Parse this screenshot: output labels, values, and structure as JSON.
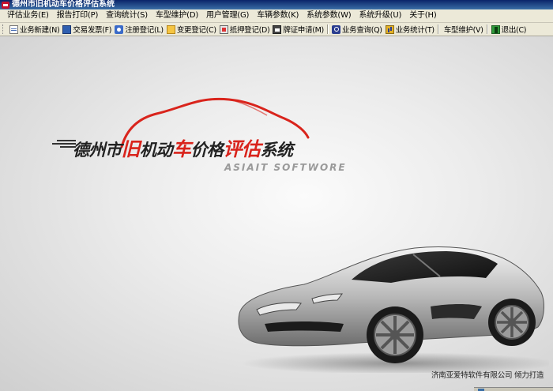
{
  "window": {
    "title": "德州市旧机动车价格评估系统"
  },
  "menu": [
    {
      "label": "评估业务(E)"
    },
    {
      "label": "报告打印(P)"
    },
    {
      "label": "查询统计(S)"
    },
    {
      "label": "车型维护(D)"
    },
    {
      "label": "用户管理(G)"
    },
    {
      "label": "车辆参数(K)"
    },
    {
      "label": "系统参数(W)"
    },
    {
      "label": "系统升级(U)"
    },
    {
      "label": "关于(H)"
    }
  ],
  "toolbar": [
    {
      "label": "业务新建(N)",
      "icon": "new-document-icon"
    },
    {
      "label": "交易发票(F)",
      "icon": "invoice-icon"
    },
    {
      "label": "注册登记(L)",
      "icon": "register-icon"
    },
    {
      "label": "变更登记(C)",
      "icon": "change-icon"
    },
    {
      "label": "抵押登记(D)",
      "icon": "pledge-icon"
    },
    {
      "label": "牌证申请(M)",
      "icon": "license-icon"
    },
    {
      "label": "业务查询(Q)",
      "icon": "search-icon"
    },
    {
      "label": "业务统计(T)",
      "icon": "stats-icon"
    },
    {
      "label": "车型维护(V)",
      "icon": "car-icon"
    },
    {
      "label": "退出(C)",
      "icon": "exit-icon"
    }
  ],
  "splash": {
    "title_part1": "德州市",
    "title_part2": "旧",
    "title_part3": "机动",
    "title_part4": "车",
    "title_part5": "价格",
    "title_part6": "评估",
    "title_part7": "系统",
    "subtitle": "ASIAIT SOFTWORE",
    "copyright": "济南亚爱特软件有限公司 倾力打造"
  },
  "colors": {
    "accent_red": "#d9241c",
    "titlebar": "#0a246a",
    "chrome": "#ece9d8"
  }
}
